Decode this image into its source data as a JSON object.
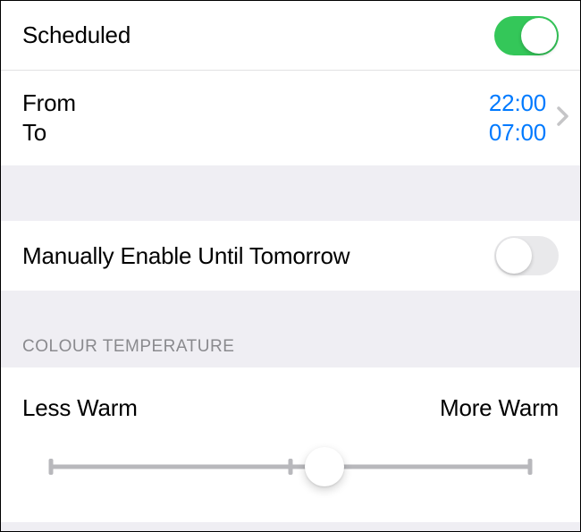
{
  "scheduled": {
    "label": "Scheduled",
    "enabled": true
  },
  "schedule_times": {
    "from_label": "From",
    "from_value": "22:00",
    "to_label": "To",
    "to_value": "07:00"
  },
  "manual": {
    "label": "Manually Enable Until Tomorrow",
    "enabled": false
  },
  "temperature_section": {
    "header": "COLOUR TEMPERATURE",
    "less_label": "Less Warm",
    "more_label": "More Warm",
    "value_percent": 57
  },
  "colors": {
    "accent_link": "#007aff",
    "toggle_on": "#34c759"
  }
}
